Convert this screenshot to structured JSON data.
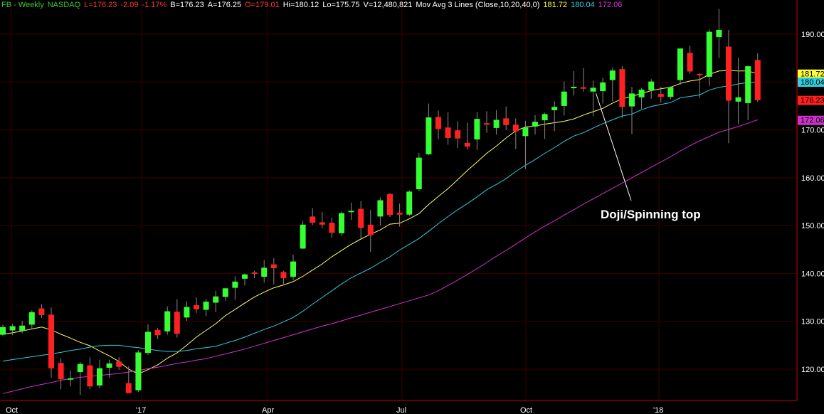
{
  "header": {
    "symbol": "FB - Weekly",
    "exchange": "NASDAQ",
    "last": "L=176.23",
    "change": "-2.09",
    "change_pct": "-1.17%",
    "bid": "B=176.23",
    "ask": "A=176.25",
    "open": "O=179.01",
    "high": "Hi=180.12",
    "low": "Lo=175.75",
    "volume": "V=12,480,821",
    "study": "Mov Avg 3 Lines (Close,10,20,40,0)",
    "ma10": "181.72",
    "ma20": "180.04",
    "ma40": "172.06"
  },
  "colors": {
    "background": "#000000",
    "up": "#33ff33",
    "down": "#ff2020",
    "ma10": "#ffff66",
    "ma20": "#33ccdd",
    "ma40": "#cc33cc",
    "grid": "#3a0000",
    "axis": "#cc0000",
    "label": "#ffffff",
    "header_green": "#33cc33",
    "header_red": "#ff3333"
  },
  "chart_data": {
    "type": "candlestick",
    "ylim": [
      114,
      196
    ],
    "y_ticks": [
      "120.00",
      "130.00",
      "140.00",
      "150.00",
      "160.00",
      "170.00",
      "180.00",
      "190.00"
    ],
    "x_labels": [
      "Oct",
      "'17",
      "Apr",
      "Jul",
      "Oct",
      "'18"
    ],
    "price_tags": [
      {
        "value": 181.72,
        "label": "181.72",
        "color": "#ffff33"
      },
      {
        "value": 180.04,
        "label": "180.04",
        "color": "#33ccdd"
      },
      {
        "value": 176.23,
        "label": "176.23",
        "color": "#ff2020"
      },
      {
        "value": 172.06,
        "label": "172.06",
        "color": "#cc33cc"
      }
    ],
    "annotation": {
      "text": "Doji/Spinning top",
      "points_to_week": 61
    },
    "candles": [
      [
        127.2,
        129.3,
        126.9,
        128.8
      ],
      [
        128.1,
        129.5,
        127.1,
        129.0
      ],
      [
        128.0,
        130.1,
        127.5,
        129.1
      ],
      [
        129.3,
        132.3,
        128.3,
        131.9
      ],
      [
        132.7,
        133.6,
        130.7,
        131.3
      ],
      [
        131.4,
        132.9,
        118.2,
        120.2
      ],
      [
        121.3,
        122.3,
        115.8,
        117.9
      ],
      [
        117.9,
        119.7,
        116.4,
        118.1
      ],
      [
        119.4,
        121.5,
        114.6,
        121.1
      ],
      [
        120.8,
        122.5,
        115.8,
        116.4
      ],
      [
        116.6,
        122.0,
        116.0,
        120.2
      ],
      [
        120.3,
        122.0,
        118.2,
        121.2
      ],
      [
        121.6,
        122.5,
        119.9,
        120.5
      ],
      [
        117.1,
        120.6,
        116.4,
        115.0
      ],
      [
        115.6,
        124.0,
        115.2,
        123.5
      ],
      [
        123.4,
        129.4,
        123.0,
        127.8
      ],
      [
        128.2,
        128.6,
        126.3,
        127.1
      ],
      [
        127.9,
        133.1,
        127.2,
        132.1
      ],
      [
        132.0,
        134.6,
        126.6,
        127.4
      ],
      [
        130.8,
        134.2,
        130.1,
        133.0
      ],
      [
        133.4,
        135.0,
        131.7,
        132.5
      ],
      [
        132.4,
        134.6,
        131.1,
        134.1
      ],
      [
        133.9,
        136.4,
        131.9,
        135.2
      ],
      [
        135.1,
        137.0,
        134.3,
        136.9
      ],
      [
        137.0,
        139.4,
        134.5,
        138.3
      ],
      [
        138.9,
        140.0,
        137.5,
        139.8
      ],
      [
        140.2,
        140.6,
        139.0,
        140.0
      ],
      [
        139.3,
        142.8,
        138.1,
        141.2
      ],
      [
        141.9,
        143.2,
        137.7,
        141.1
      ],
      [
        140.3,
        140.6,
        137.8,
        139.0
      ],
      [
        139.3,
        143.9,
        138.6,
        142.5
      ],
      [
        145.2,
        151.0,
        145.1,
        150.2
      ],
      [
        151.9,
        153.6,
        150.1,
        150.6
      ],
      [
        150.7,
        152.8,
        149.4,
        150.2
      ],
      [
        150.6,
        151.7,
        147.4,
        148.5
      ],
      [
        148.4,
        152.9,
        147.9,
        152.6
      ],
      [
        152.9,
        154.8,
        151.2,
        153.1
      ],
      [
        153.5,
        155.1,
        147.2,
        149.5
      ],
      [
        150.2,
        153.3,
        144.5,
        148.0
      ],
      [
        151.9,
        155.9,
        150.0,
        155.3
      ],
      [
        156.6,
        156.8,
        151.8,
        152.2
      ],
      [
        152.7,
        154.6,
        149.8,
        152.3
      ],
      [
        152.3,
        157.4,
        152.0,
        157.1
      ],
      [
        157.6,
        165.2,
        157.2,
        164.2
      ],
      [
        164.9,
        175.5,
        164.7,
        172.6
      ],
      [
        172.7,
        174.0,
        168.0,
        170.2
      ],
      [
        170.5,
        173.7,
        166.9,
        168.3
      ],
      [
        169.9,
        171.8,
        166.2,
        168.2
      ],
      [
        167.3,
        171.5,
        165.9,
        166.5
      ],
      [
        168.0,
        173.7,
        165.8,
        172.3
      ],
      [
        171.4,
        173.9,
        169.4,
        171.2
      ],
      [
        170.4,
        174.1,
        169.0,
        172.1
      ],
      [
        172.4,
        174.9,
        170.0,
        171.0
      ],
      [
        171.1,
        172.4,
        166.0,
        169.7
      ],
      [
        168.7,
        171.9,
        161.8,
        170.5
      ],
      [
        170.7,
        173.1,
        169.0,
        171.7
      ],
      [
        172.0,
        173.6,
        168.1,
        173.3
      ],
      [
        174.1,
        176.0,
        169.7,
        174.8
      ],
      [
        175.0,
        180.1,
        173.0,
        178.0
      ],
      [
        178.7,
        182.3,
        177.2,
        179.0
      ],
      [
        178.9,
        182.9,
        178.0,
        178.8
      ],
      [
        178.0,
        180.3,
        172.9,
        178.8
      ],
      [
        178.1,
        180.9,
        175.5,
        179.9
      ],
      [
        180.4,
        183.0,
        176.0,
        182.4
      ],
      [
        182.7,
        183.3,
        172.5,
        174.8
      ],
      [
        174.9,
        179.0,
        169.1,
        177.6
      ],
      [
        176.8,
        178.8,
        174.4,
        178.4
      ],
      [
        178.3,
        180.6,
        176.5,
        180.1
      ],
      [
        177.5,
        179.0,
        175.7,
        176.9
      ],
      [
        176.9,
        179.1,
        176.4,
        178.9
      ],
      [
        180.4,
        187.0,
        179.4,
        187.0
      ],
      [
        186.1,
        187.6,
        181.7,
        182.2
      ],
      [
        181.7,
        181.8,
        176.6,
        181.5
      ],
      [
        181.1,
        191.0,
        179.2,
        190.5
      ],
      [
        189.4,
        195.3,
        185.0,
        190.9
      ],
      [
        187.4,
        190.9,
        167.2,
        176.1
      ],
      [
        175.9,
        185.1,
        171.2,
        176.8
      ],
      [
        175.6,
        183.4,
        172.0,
        183.3
      ],
      [
        184.6,
        186.0,
        175.8,
        176.2
      ]
    ],
    "series": [
      {
        "name": "10-week MA (181.72)",
        "values": [
          127.3,
          127.6,
          128.0,
          128.4,
          128.8,
          128.2,
          127.3,
          126.5,
          125.6,
          124.9,
          123.8,
          122.8,
          121.6,
          120.0,
          119.0,
          119.9,
          120.9,
          122.3,
          123.4,
          125.0,
          126.7,
          128.1,
          129.5,
          131.2,
          132.5,
          133.8,
          135.1,
          136.1,
          137.0,
          137.6,
          138.3,
          139.4,
          140.7,
          142.0,
          143.5,
          144.8,
          146.1,
          147.2,
          148.2,
          149.1,
          150.3,
          150.5,
          151.4,
          152.5,
          154.4,
          156.1,
          157.7,
          159.6,
          161.5,
          163.3,
          165.1,
          166.6,
          168.3,
          169.8,
          170.6,
          170.8,
          171.2,
          171.5,
          171.8,
          172.3,
          173.1,
          173.8,
          174.5,
          175.6,
          176.5,
          177.0,
          177.6,
          178.2,
          178.6,
          178.9,
          179.7,
          180.2,
          180.5,
          181.6,
          182.3,
          182.4,
          182.3,
          182.3,
          181.7
        ]
      },
      {
        "name": "20-week MA (180.04)",
        "values": [
          121.7,
          122.0,
          122.3,
          122.6,
          122.9,
          123.2,
          123.5,
          123.9,
          124.2,
          124.6,
          124.9,
          125.0,
          125.0,
          124.7,
          124.5,
          124.2,
          123.9,
          123.7,
          123.7,
          123.9,
          124.3,
          124.5,
          124.8,
          125.4,
          126.0,
          126.7,
          127.5,
          128.3,
          129.0,
          129.9,
          130.8,
          132.1,
          133.6,
          135.0,
          136.4,
          137.8,
          139.1,
          140.1,
          141.1,
          142.3,
          143.5,
          144.9,
          146.1,
          147.3,
          148.8,
          150.4,
          151.9,
          153.3,
          154.6,
          156.0,
          157.5,
          158.6,
          159.8,
          161.3,
          162.6,
          163.8,
          165.1,
          166.3,
          167.6,
          168.7,
          169.4,
          170.4,
          171.3,
          172.1,
          172.9,
          173.3,
          174.2,
          174.9,
          175.3,
          175.7,
          176.7,
          177.0,
          177.3,
          178.3,
          178.9,
          179.2,
          179.6,
          179.9,
          180.0
        ]
      },
      {
        "name": "40-week MA (172.06)",
        "values": [
          114.9,
          115.4,
          115.9,
          116.4,
          116.8,
          117.2,
          117.7,
          118.0,
          118.3,
          118.5,
          118.7,
          118.9,
          119.1,
          119.4,
          119.7,
          120.1,
          120.4,
          120.8,
          121.2,
          121.5,
          121.9,
          122.2,
          122.7,
          123.2,
          123.7,
          124.2,
          124.8,
          125.4,
          126.0,
          126.6,
          127.2,
          127.8,
          128.4,
          129.0,
          129.5,
          130.1,
          130.7,
          131.3,
          131.9,
          132.5,
          133.1,
          133.7,
          134.3,
          134.9,
          135.5,
          136.4,
          137.5,
          138.6,
          139.8,
          141.0,
          142.3,
          143.6,
          144.8,
          146.1,
          147.4,
          148.7,
          149.9,
          151.0,
          152.2,
          153.3,
          154.5,
          155.6,
          156.7,
          157.8,
          158.9,
          160.0,
          161.1,
          162.2,
          163.3,
          164.4,
          165.6,
          166.7,
          167.7,
          168.6,
          169.5,
          170.1,
          170.7,
          171.4,
          172.1
        ]
      }
    ]
  }
}
